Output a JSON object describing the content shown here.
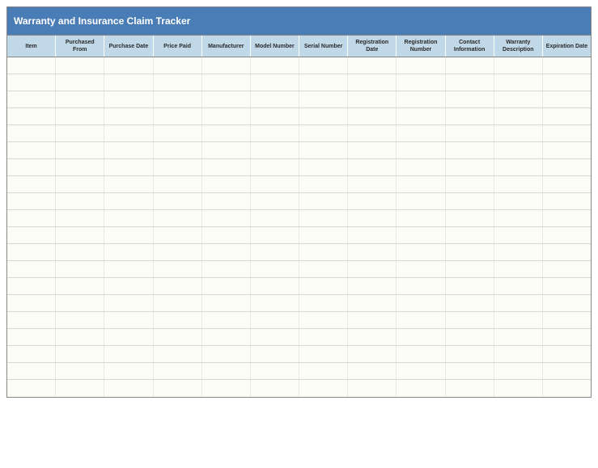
{
  "title": "Warranty and Insurance Claim Tracker",
  "columns": [
    "Item",
    "Purchased From",
    "Purchase Date",
    "Price Paid",
    "Manufacturer",
    "Model Number",
    "Serial Number",
    "Registration Date",
    "Registration Number",
    "Contact Information",
    "Warranty Description",
    "Expiration Date"
  ],
  "rows": [
    [
      "",
      "",
      "",
      "",
      "",
      "",
      "",
      "",
      "",
      "",
      "",
      ""
    ],
    [
      "",
      "",
      "",
      "",
      "",
      "",
      "",
      "",
      "",
      "",
      "",
      ""
    ],
    [
      "",
      "",
      "",
      "",
      "",
      "",
      "",
      "",
      "",
      "",
      "",
      ""
    ],
    [
      "",
      "",
      "",
      "",
      "",
      "",
      "",
      "",
      "",
      "",
      "",
      ""
    ],
    [
      "",
      "",
      "",
      "",
      "",
      "",
      "",
      "",
      "",
      "",
      "",
      ""
    ],
    [
      "",
      "",
      "",
      "",
      "",
      "",
      "",
      "",
      "",
      "",
      "",
      ""
    ],
    [
      "",
      "",
      "",
      "",
      "",
      "",
      "",
      "",
      "",
      "",
      "",
      ""
    ],
    [
      "",
      "",
      "",
      "",
      "",
      "",
      "",
      "",
      "",
      "",
      "",
      ""
    ],
    [
      "",
      "",
      "",
      "",
      "",
      "",
      "",
      "",
      "",
      "",
      "",
      ""
    ],
    [
      "",
      "",
      "",
      "",
      "",
      "",
      "",
      "",
      "",
      "",
      "",
      ""
    ],
    [
      "",
      "",
      "",
      "",
      "",
      "",
      "",
      "",
      "",
      "",
      "",
      ""
    ],
    [
      "",
      "",
      "",
      "",
      "",
      "",
      "",
      "",
      "",
      "",
      "",
      ""
    ],
    [
      "",
      "",
      "",
      "",
      "",
      "",
      "",
      "",
      "",
      "",
      "",
      ""
    ],
    [
      "",
      "",
      "",
      "",
      "",
      "",
      "",
      "",
      "",
      "",
      "",
      ""
    ],
    [
      "",
      "",
      "",
      "",
      "",
      "",
      "",
      "",
      "",
      "",
      "",
      ""
    ],
    [
      "",
      "",
      "",
      "",
      "",
      "",
      "",
      "",
      "",
      "",
      "",
      ""
    ],
    [
      "",
      "",
      "",
      "",
      "",
      "",
      "",
      "",
      "",
      "",
      "",
      ""
    ],
    [
      "",
      "",
      "",
      "",
      "",
      "",
      "",
      "",
      "",
      "",
      "",
      ""
    ],
    [
      "",
      "",
      "",
      "",
      "",
      "",
      "",
      "",
      "",
      "",
      "",
      ""
    ],
    [
      "",
      "",
      "",
      "",
      "",
      "",
      "",
      "",
      "",
      "",
      "",
      ""
    ]
  ]
}
